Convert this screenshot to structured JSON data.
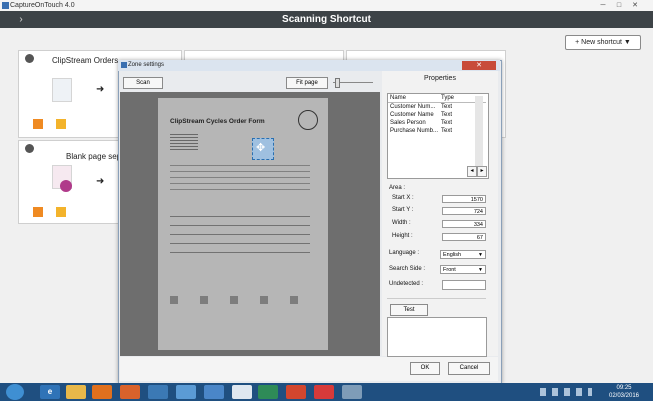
{
  "app": {
    "title": "CaptureOnTouch 4.0"
  },
  "header": {
    "back_icon": "chevron-left-icon",
    "title": "Scanning Shortcut"
  },
  "toolbar": {
    "new_shortcut": "+ New shortcut ▼"
  },
  "cards": [
    {
      "label": "ClipStream Orders a"
    },
    {
      "label": "Blank page sepa"
    }
  ],
  "dialog": {
    "title": "Zone settings",
    "scan_button": "Scan",
    "fit_page_button": "Fit page",
    "ok_button": "OK",
    "cancel_button": "Cancel"
  },
  "document": {
    "heading": "ClipStream Cycles Order Form"
  },
  "properties": {
    "title": "Properties",
    "columns": [
      "Name",
      "Type"
    ],
    "rows": [
      {
        "name": "Customer Num...",
        "type": "Text"
      },
      {
        "name": "Customer Name",
        "type": "Text"
      },
      {
        "name": "Sales Person",
        "type": "Text"
      },
      {
        "name": "Purchase Numb...",
        "type": "Text"
      }
    ],
    "area_label": "Area :",
    "start_x_label": "Start X :",
    "start_x": "1570",
    "start_y_label": "Start Y :",
    "start_y": "724",
    "width_label": "Width :",
    "width": "334",
    "height_label": "Height :",
    "height": "67",
    "language_label": "Language :",
    "language": "English",
    "search_side_label": "Search Side :",
    "search_side": "Front",
    "undetected_label": "Undetected :",
    "undetected": "",
    "test_button": "Test"
  },
  "taskbar": {
    "time": "09:25",
    "date": "02/03/2016"
  },
  "colors": {
    "header_bg": "#3d4347",
    "taskbar_bg": "#1f4f80",
    "accent_orange": "#ef8a22"
  }
}
